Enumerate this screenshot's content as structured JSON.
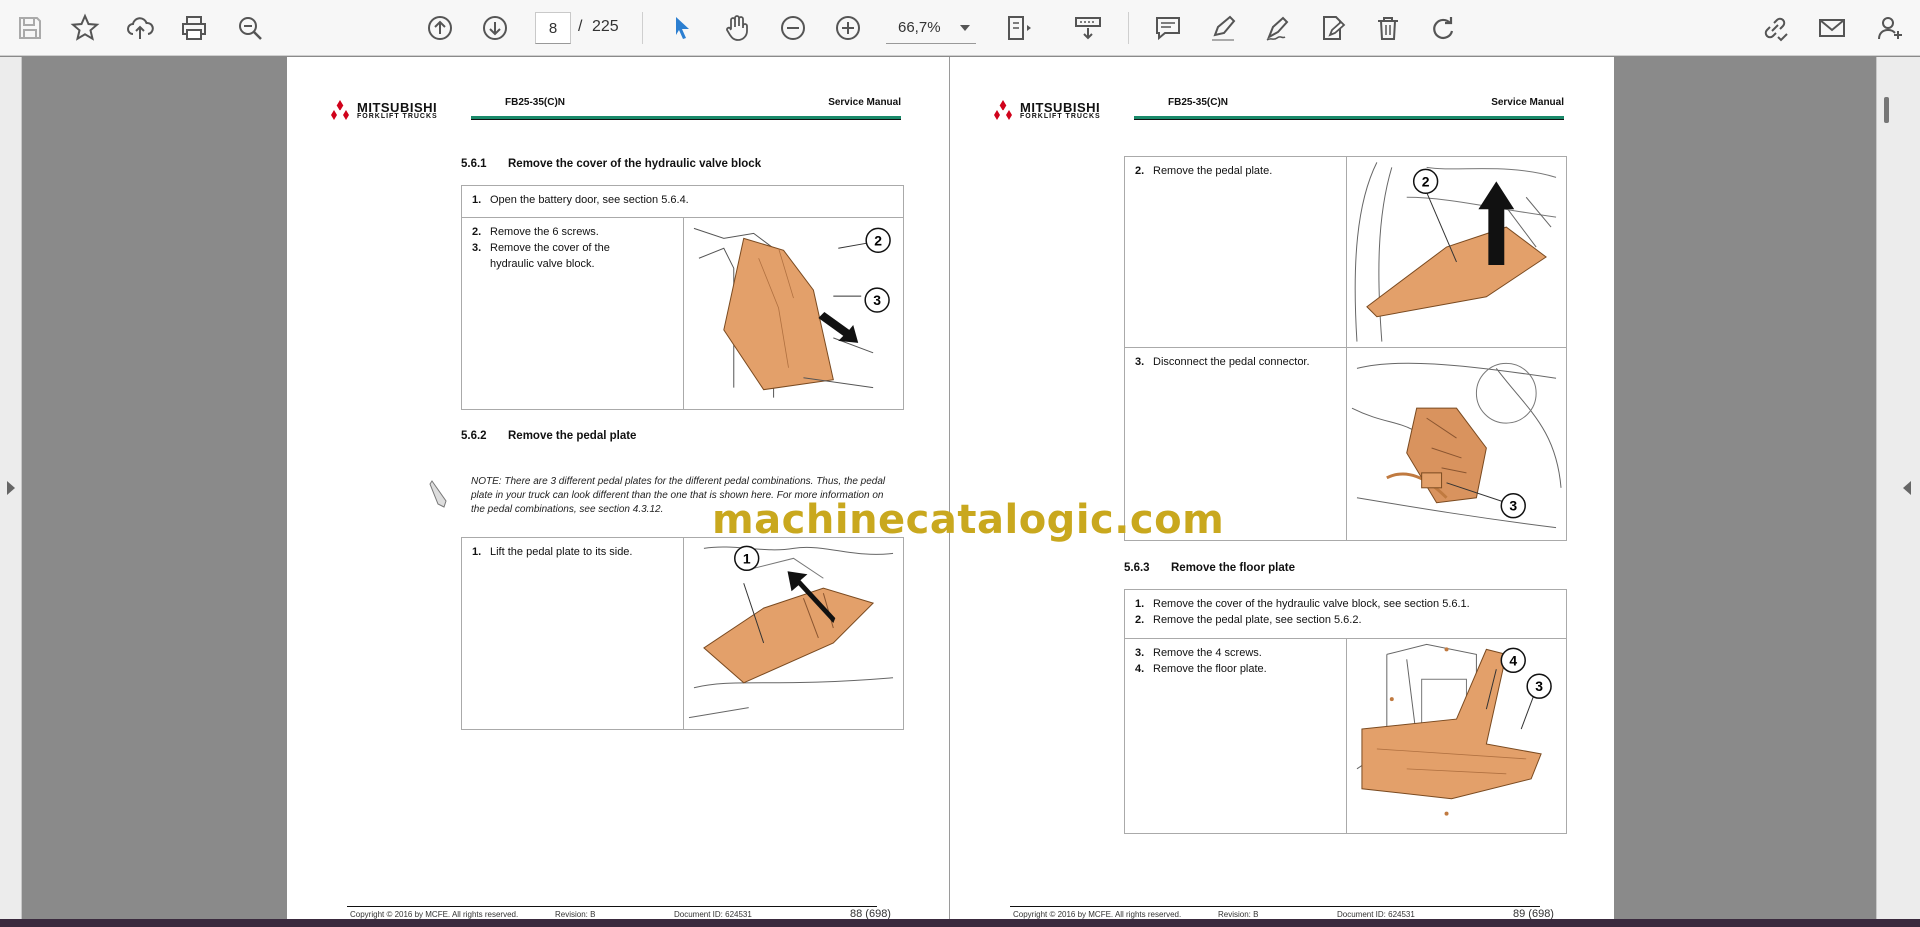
{
  "toolbar": {
    "page_current": "8",
    "page_separator": "/",
    "page_total": "225",
    "zoom": "66,7%"
  },
  "watermark": "machinecatalogic.com",
  "pages": {
    "left": {
      "header": {
        "brand": "MITSUBISHI",
        "brand_sub": "FORKLIFT TRUCKS",
        "model": "FB25-35(C)N",
        "title": "Service Manual"
      },
      "sec1": {
        "num": "5.6.1",
        "title": "Remove the cover of the hydraulic valve block"
      },
      "sec1_steps": {
        "s1": {
          "n": "1.",
          "text": "Open the battery door, see section 5.6.4."
        },
        "s2": {
          "n": "2.",
          "text": "Remove the 6 screws."
        },
        "s3": {
          "n": "3.",
          "text": "Remove the cover of the",
          "text2": "hydraulic valve block."
        }
      },
      "sec1_callouts": [
        "2",
        "3"
      ],
      "sec2": {
        "num": "5.6.2",
        "title": "Remove the pedal plate"
      },
      "note": "NOTE: There are 3 different pedal plates for the different pedal combinations. Thus, the pedal plate in your truck can look different than the one that is shown here. For more information on the pedal combinations, see section 4.3.12.",
      "sec2_steps": {
        "s1": {
          "n": "1.",
          "text": "Lift the pedal plate to its side."
        }
      },
      "sec2_callouts": [
        "1"
      ],
      "footer": {
        "copyright": "Copyright © 2016 by MCFE. All rights reserved.",
        "revision": "Revision: B",
        "document": "Document ID: 624531",
        "page": "88 (698)"
      }
    },
    "right": {
      "header": {
        "brand": "MITSUBISHI",
        "brand_sub": "FORKLIFT TRUCKS",
        "model": "FB25-35(C)N",
        "title": "Service Manual"
      },
      "steps_a": {
        "s2": {
          "n": "2.",
          "text": "Remove the pedal plate."
        },
        "s3": {
          "n": "3.",
          "text": "Disconnect the pedal connector."
        }
      },
      "callouts_a": [
        "2",
        "3"
      ],
      "sec3": {
        "num": "5.6.3",
        "title": "Remove the floor plate"
      },
      "sec3_steps": {
        "s1": {
          "n": "1.",
          "text": "Remove the cover of the hydraulic valve block, see section 5.6.1."
        },
        "s2": {
          "n": "2.",
          "text": "Remove the pedal plate, see section 5.6.2."
        },
        "s3": {
          "n": "3.",
          "text": "Remove the 4 screws."
        },
        "s4": {
          "n": "4.",
          "text": "Remove the floor plate."
        }
      },
      "sec3_callouts": [
        "4",
        "3"
      ],
      "footer": {
        "copyright": "Copyright © 2016 by MCFE. All rights reserved.",
        "revision": "Revision: B",
        "document": "Document ID: 624531",
        "page": "89 (698)"
      }
    }
  },
  "icons": [
    "save-icon",
    "bookmark-star-icon",
    "upload-cloud-icon",
    "print-icon",
    "zoom-search-icon",
    "page-up-icon",
    "page-down-icon",
    "select-cursor-icon",
    "hand-tool-icon",
    "zoom-out-icon",
    "zoom-in-icon",
    "page-fit-icon",
    "form-fill-icon",
    "comment-icon",
    "highlight-pen-icon",
    "sign-pen-icon",
    "edit-document-icon",
    "delete-trash-icon",
    "redo-icon",
    "share-link-icon",
    "email-icon",
    "add-user-icon"
  ],
  "colors": {
    "accent": "#2c7fd1",
    "page_bg": "#8a8a8a",
    "watermark": "#c9a81e",
    "part_orange": "#e3a06a",
    "header_rule": "#1a8a6a"
  }
}
